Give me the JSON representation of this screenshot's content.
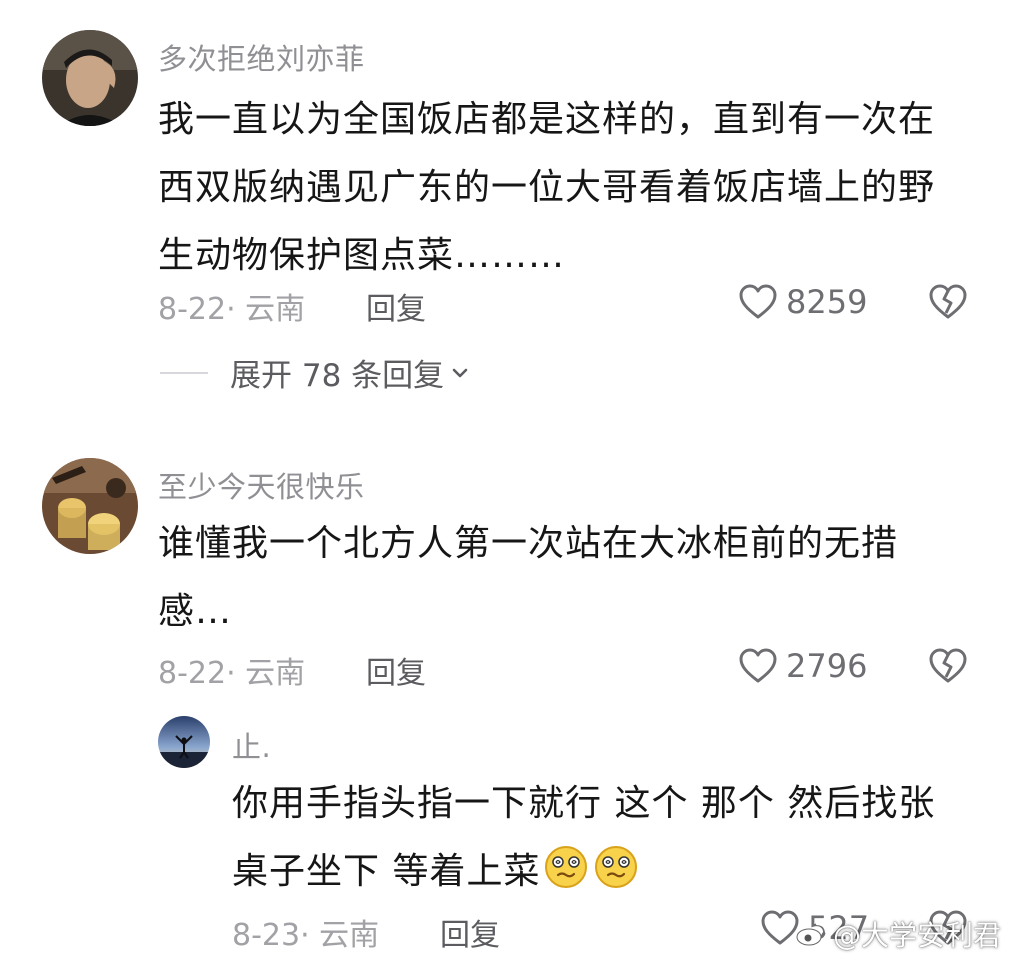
{
  "comments": [
    {
      "username": "多次拒绝刘亦菲",
      "text": "我一直以为全国饭店都是这样的，直到有一次在西双版纳遇见广东的一位大哥看着饭店墙上的野生动物保护图点菜………",
      "meta": "8-22· 云南",
      "reply_label": "回复",
      "likes": "8259",
      "expand_label": "展开 78 条回复"
    },
    {
      "username": "至少今天很快乐",
      "text": "谁懂我一个北方人第一次站在大冰柜前的无措感…",
      "meta": "8-22· 云南",
      "reply_label": "回复",
      "likes": "2796"
    }
  ],
  "reply": {
    "username": "止.",
    "text": "你用手指头指一下就行  这个   那个  然后找张桌子坐下   等着上菜",
    "meta": "8-23· 云南",
    "reply_label": "回复",
    "likes": "527"
  },
  "watermark": {
    "text": "@大学安利君"
  },
  "icons": {
    "like": "heart-outline-icon",
    "dislike": "broken-heart-icon",
    "expand": "chevron-down-icon",
    "emoji": "dizzy-face-emoji-icon",
    "watermark_logo": "weibo-logo-icon"
  },
  "colors": {
    "username": "#8f8f94",
    "body": "#161616",
    "meta": "#a2a2a6"
  }
}
